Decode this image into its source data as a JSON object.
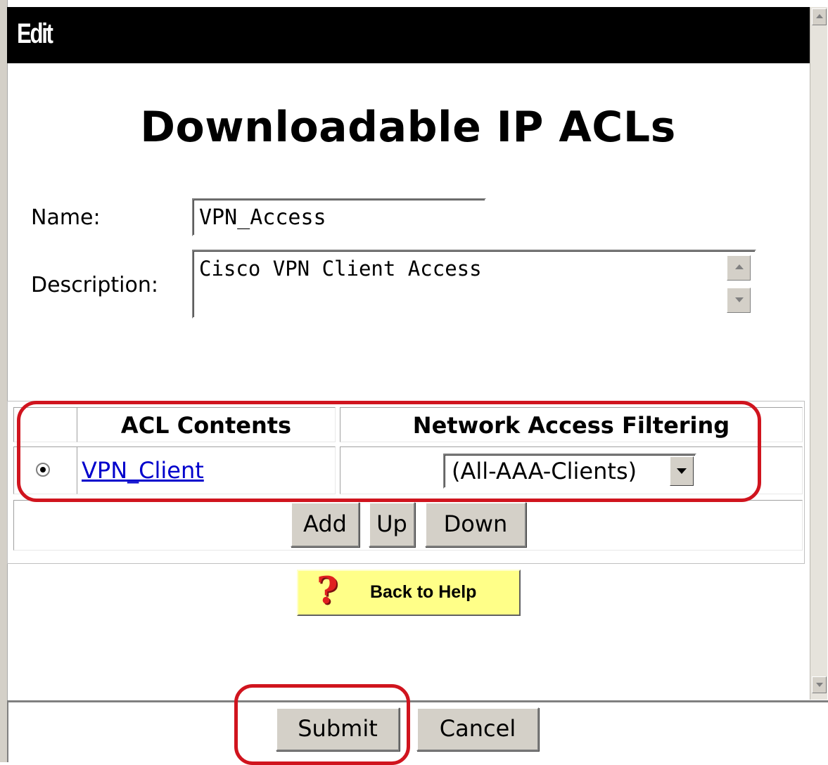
{
  "window": {
    "title": "Edit"
  },
  "page": {
    "heading": "Downloadable IP ACLs"
  },
  "form": {
    "name_label": "Name:",
    "name_value": "VPN_Access",
    "description_label": "Description:",
    "description_value": "Cisco VPN Client Access"
  },
  "table": {
    "headers": [
      "ACL Contents",
      "Network Access Filtering"
    ],
    "rows": [
      {
        "selected": true,
        "acl": "VPN_Client",
        "filter": "(All-AAA-Clients)"
      }
    ],
    "buttons": {
      "add": "Add",
      "up": "Up",
      "down": "Down"
    }
  },
  "help": {
    "label": "Back to Help",
    "icon": "question-mark-icon"
  },
  "actions": {
    "submit": "Submit",
    "cancel": "Cancel"
  },
  "colors": {
    "titlebar": "#000000",
    "highlight": "#d0141e",
    "help_button": "#ffff88",
    "link": "#0000cc"
  }
}
